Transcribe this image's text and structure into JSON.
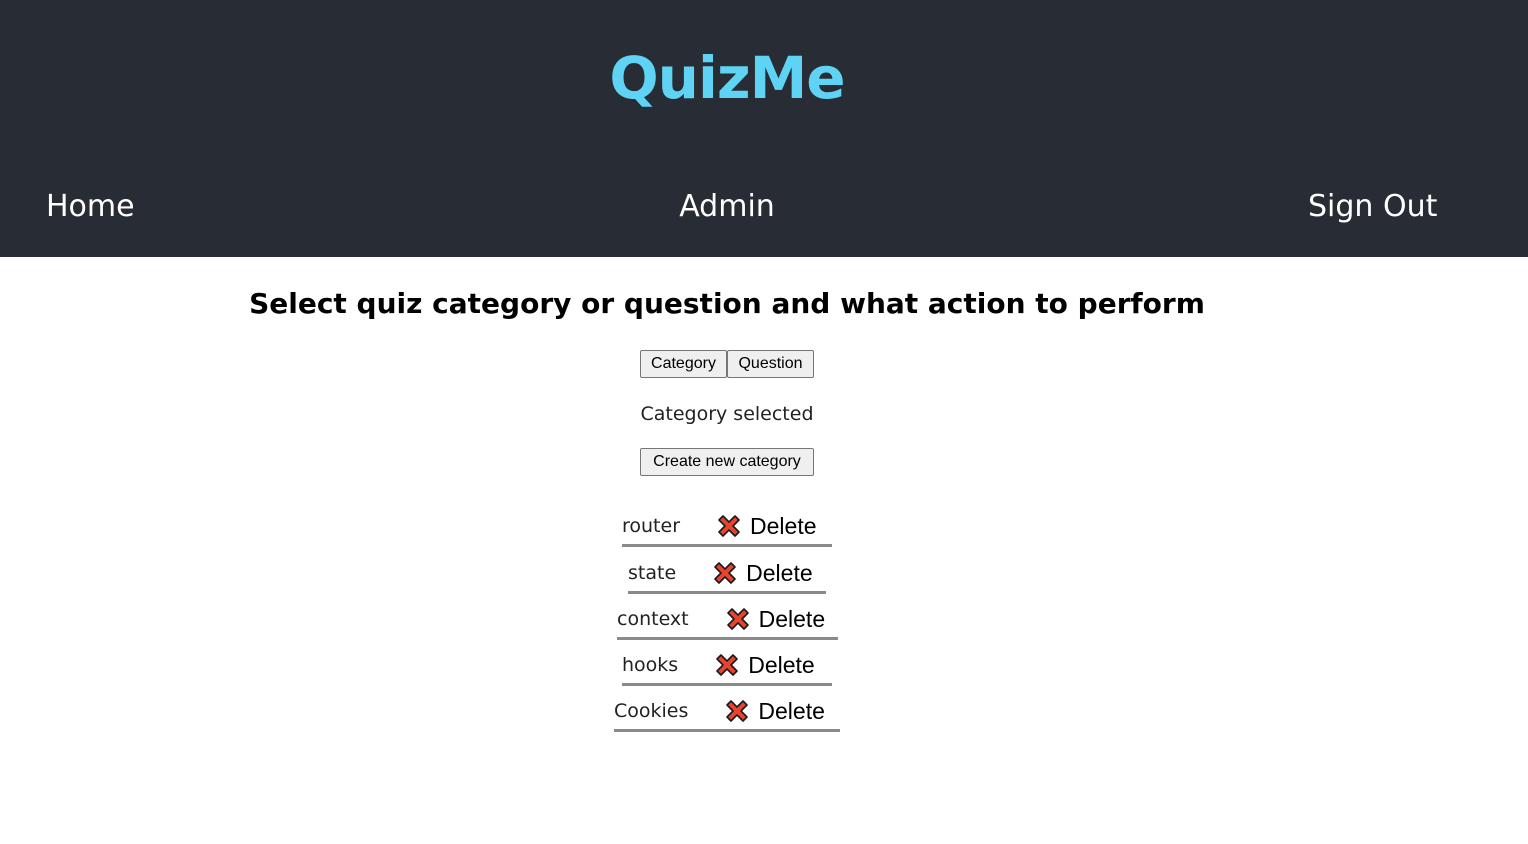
{
  "app": {
    "brand": "QuizMe"
  },
  "nav": {
    "home": "Home",
    "admin": "Admin",
    "sign_out": "Sign Out"
  },
  "main": {
    "title": "Select quiz category or question and what action to perform",
    "toggle": {
      "category_label": "Category",
      "question_label": "Question"
    },
    "selected_text": "Category selected",
    "create_button": "Create new category",
    "categories": [
      {
        "name": "router",
        "delete_label": "Delete",
        "icon": "close-x-icon"
      },
      {
        "name": "state",
        "delete_label": "Delete",
        "icon": "close-x-icon"
      },
      {
        "name": "context",
        "delete_label": "Delete",
        "icon": "close-x-icon"
      },
      {
        "name": "hooks",
        "delete_label": "Delete",
        "icon": "close-x-icon"
      },
      {
        "name": "Cookies",
        "delete_label": "Delete",
        "icon": "close-x-icon"
      }
    ]
  },
  "colors": {
    "header_bg": "#282c34",
    "brand": "#5fd3f3",
    "delete_icon": "#e8432e"
  }
}
